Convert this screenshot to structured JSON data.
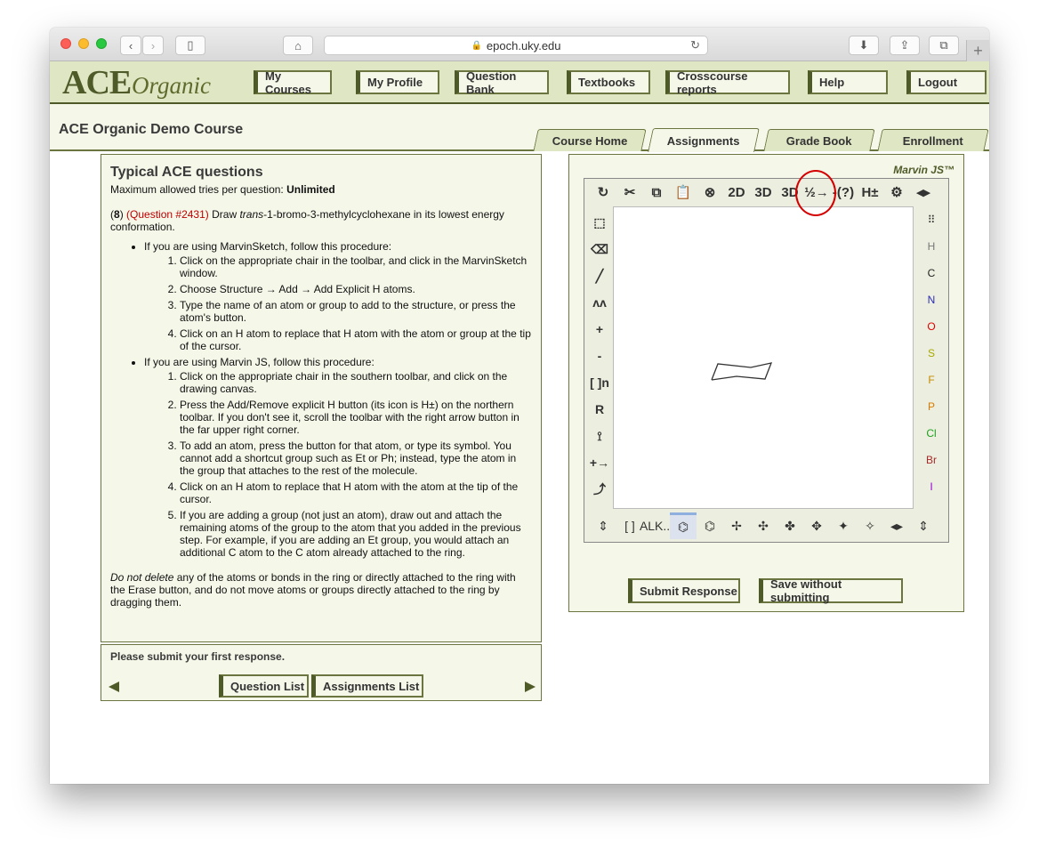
{
  "browser": {
    "url": "epoch.uky.edu"
  },
  "header": {
    "logo_ace": "ACE",
    "logo_organic": "Organic",
    "nav": [
      {
        "label": "My Courses"
      },
      {
        "label": "My Profile"
      },
      {
        "label": "Question Bank"
      },
      {
        "label": "Textbooks"
      },
      {
        "label": "Crosscourse reports"
      },
      {
        "label": "Help"
      },
      {
        "label": "Logout"
      }
    ]
  },
  "course": {
    "title": "ACE Organic Demo Course",
    "tabs": [
      {
        "label": "Course Home"
      },
      {
        "label": "Assignments",
        "active": true
      },
      {
        "label": "Grade Book"
      },
      {
        "label": "Enrollment"
      }
    ]
  },
  "question": {
    "heading": "Typical ACE questions",
    "tries_label": "Maximum allowed tries per question:",
    "tries_value": "Unlimited",
    "number": "8",
    "question_ref": "(Question #2431)",
    "prompt_pre": "Draw",
    "prompt_italic": "trans",
    "prompt_post": "-1-bromo-3-methylcyclohexane in its lowest energy conformation.",
    "procedures": [
      {
        "intro": "If you are using MarvinSketch, follow this procedure:",
        "steps": [
          "Click on the appropriate chair in the toolbar, and click in the MarvinSketch window.",
          "Choose Structure → Add → Add Explicit H atoms.",
          "Type the name of an atom or group to add to the structure, or press the atom's button.",
          "Click on an H atom to replace that H atom with the atom or group at the tip of the cursor."
        ]
      },
      {
        "intro": "If you are using Marvin JS, follow this procedure:",
        "steps": [
          "Click on the appropriate chair in the southern toolbar, and click on the drawing canvas.",
          "Press the Add/Remove explicit H button (its icon is H±) on the northern toolbar. If you don't see it, scroll the toolbar with the right arrow button in the far upper right corner.",
          "To add an atom, press the button for that atom, or type its symbol. You cannot add a shortcut group such as Et or Ph; instead, type the atom in the group that attaches to the rest of the molecule.",
          "Click on an H atom to replace that H atom with the atom at the tip of the cursor.",
          "If you are adding a group (not just an atom), draw out and attach the remaining atoms of the group to the atom that you added in the previous step. For example, if you are adding an Et group, you would attach an additional C atom to the C atom already attached to the ring."
        ]
      }
    ],
    "note_italic": "Do not delete",
    "note_rest": "any of the atoms or bonds in the ring or directly attached to the ring with the Erase button, and do not move atoms or groups directly attached to the ring by dragging them."
  },
  "status": {
    "message": "Please submit your first response.",
    "question_list": "Question List",
    "assignments_list": "Assignments List"
  },
  "marvin": {
    "title": "Marvin JS™",
    "top_tools": [
      {
        "icon": "redo-icon",
        "glyph": "↻"
      },
      {
        "icon": "cut-icon",
        "glyph": "✂"
      },
      {
        "icon": "copy-icon",
        "glyph": "⧉"
      },
      {
        "icon": "paste-icon",
        "glyph": "📋"
      },
      {
        "icon": "zoom-icon",
        "glyph": "⊗"
      },
      {
        "icon": "clean-2d-icon",
        "glyph": "2D"
      },
      {
        "icon": "clean-3d-icon",
        "glyph": "3D"
      },
      {
        "icon": "rotate-3d-icon",
        "glyph": "3D"
      },
      {
        "icon": "numbering-icon",
        "glyph": "½→"
      },
      {
        "icon": "query-icon",
        "glyph": "-(?)"
      },
      {
        "icon": "explicit-h-icon",
        "glyph": "H±"
      },
      {
        "icon": "settings-icon",
        "glyph": "⚙"
      },
      {
        "icon": "scroll-arrows-icon",
        "glyph": "◂▸"
      }
    ],
    "left_tools": [
      {
        "icon": "select-icon",
        "glyph": "⬚"
      },
      {
        "icon": "erase-icon",
        "glyph": "⌫"
      },
      {
        "icon": "single-bond-icon",
        "glyph": "╱"
      },
      {
        "icon": "chain-icon",
        "glyph": "ʌʌ"
      },
      {
        "icon": "charge-plus-icon",
        "glyph": "+"
      },
      {
        "icon": "charge-minus-icon",
        "glyph": "-"
      },
      {
        "icon": "bracket-icon",
        "glyph": "[ ]n"
      },
      {
        "icon": "rgroup-icon",
        "glyph": "R"
      },
      {
        "icon": "attach-icon",
        "glyph": "⟟"
      },
      {
        "icon": "reaction-arrow-icon",
        "glyph": "+→"
      },
      {
        "icon": "mechanism-arrow-icon",
        "glyph": "⤴"
      }
    ],
    "atoms": [
      {
        "symbol": "",
        "color": "#333333"
      },
      {
        "symbol": "H",
        "color": "#777777"
      },
      {
        "symbol": "C",
        "color": "#222222"
      },
      {
        "symbol": "N",
        "color": "#2b2bb8"
      },
      {
        "symbol": "O",
        "color": "#e00000"
      },
      {
        "symbol": "S",
        "color": "#a8a800"
      },
      {
        "symbol": "F",
        "color": "#c48a00"
      },
      {
        "symbol": "P",
        "color": "#d67a00"
      },
      {
        "symbol": "Cl",
        "color": "#1fa01f"
      },
      {
        "symbol": "Br",
        "color": "#a52a2a"
      },
      {
        "symbol": "I",
        "color": "#9400d3"
      }
    ],
    "bottom_tools": [
      {
        "icon": "scroll-updown-icon",
        "glyph": "⇕"
      },
      {
        "icon": "template-library-icon",
        "glyph": "[ ]"
      },
      {
        "icon": "alkane-icon",
        "glyph": "ALK..."
      },
      {
        "icon": "chair-1-icon",
        "glyph": "⌬"
      },
      {
        "icon": "chair-2-icon",
        "glyph": "⌬"
      },
      {
        "icon": "newman-1-icon",
        "glyph": "✢"
      },
      {
        "icon": "newman-2-icon",
        "glyph": "✣"
      },
      {
        "icon": "newman-3-icon",
        "glyph": "✤"
      },
      {
        "icon": "newman-4-icon",
        "glyph": "✥"
      },
      {
        "icon": "newman-5-icon",
        "glyph": "✦"
      },
      {
        "icon": "newman-6-icon",
        "glyph": "✧"
      },
      {
        "icon": "scroll-leftright-icon",
        "glyph": "◂▸"
      },
      {
        "icon": "scroll-updown-2-icon",
        "glyph": "⇕"
      }
    ]
  },
  "actions": {
    "submit": "Submit Response",
    "save": "Save without submitting"
  }
}
